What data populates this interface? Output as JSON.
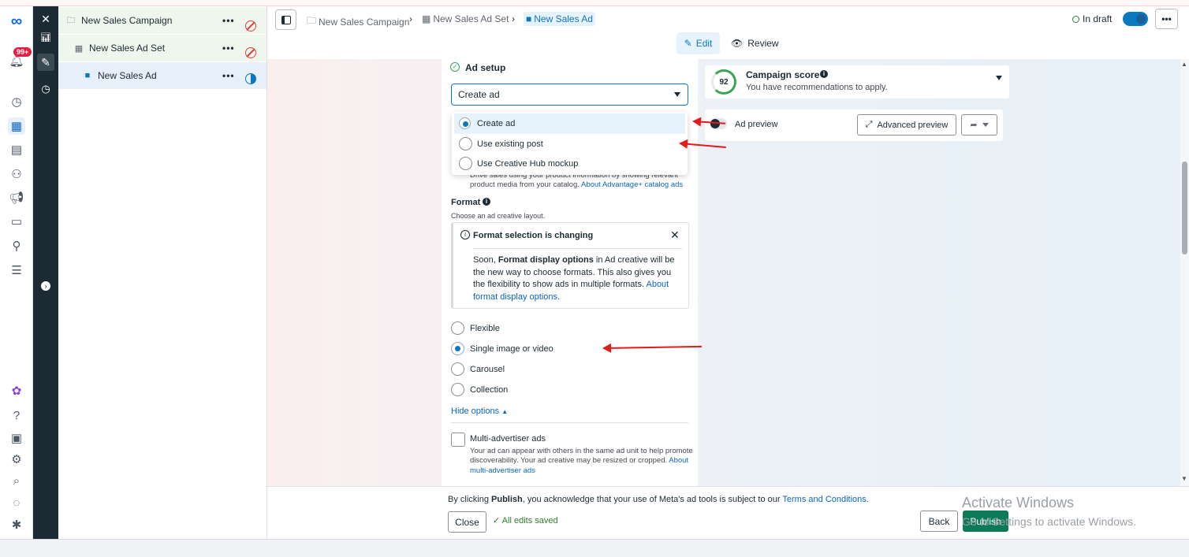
{
  "tree": {
    "campaign": "New Sales Campaign",
    "ad_set": "New Sales Ad Set",
    "ad": "New Sales Ad",
    "more": "•••"
  },
  "rail": {
    "notif_badge": "99+"
  },
  "breadcrumb": {
    "campaign": "New Sales Campaign",
    "ad_set": "New Sales Ad Set",
    "ad": "New Sales Ad"
  },
  "header": {
    "status": "In draft",
    "more": "•••",
    "tab_edit": "Edit",
    "tab_review": "Review"
  },
  "ad_setup": {
    "title": "Ad setup",
    "select_value": "Create ad",
    "options": [
      "Create ad",
      "Use existing post",
      "Use Creative Hub mockup"
    ],
    "catalog_text_line1": "Drive sales using your product information by showing relevant",
    "catalog_text_line2": "product media from your catalog.",
    "catalog_link": "About Advantage+ catalog ads"
  },
  "format": {
    "title": "Format",
    "subtitle": "Choose an ad creative layout.",
    "notice_title": "Format selection is changing",
    "notice_p1": "Soon, ",
    "notice_bold": "Format display options",
    "notice_p2": " in Ad creative will be the new way to choose formats. This also gives you the flexibility to show ads in multiple formats. ",
    "notice_link": "About format display options.",
    "options": [
      "Flexible",
      "Single image or video",
      "Carousel",
      "Collection"
    ],
    "selected": "Single image or video",
    "hide_options": "Hide options"
  },
  "multi_advertiser": {
    "title": "Multi-advertiser ads",
    "desc_line1": "Your ad can appear with others in the same ad unit to help promote",
    "desc_line2": "discoverability. Your ad creative may be resized or cropped.",
    "link_a": "About",
    "link_b": "multi-advertiser ads"
  },
  "score": {
    "value": "92",
    "title": "Campaign score",
    "subtitle": "You have recommendations to apply."
  },
  "preview": {
    "label": "Ad preview",
    "advanced": "Advanced preview"
  },
  "footer": {
    "consent_pre": "By clicking ",
    "consent_bold": "Publish",
    "consent_mid": ", you acknowledge that your use of Meta's ad tools is subject to our ",
    "consent_link": "Terms and Conditions",
    "consent_end": ".",
    "close": "Close",
    "saved": "All edits saved",
    "back": "Back",
    "publish": "Publish"
  },
  "watermark": {
    "title": "Activate Windows",
    "subtitle": "Go to Settings to activate Windows."
  },
  "colors": {
    "accent": "#0a78be",
    "publish": "#0b7a57",
    "arrow": "#e01b1b"
  }
}
